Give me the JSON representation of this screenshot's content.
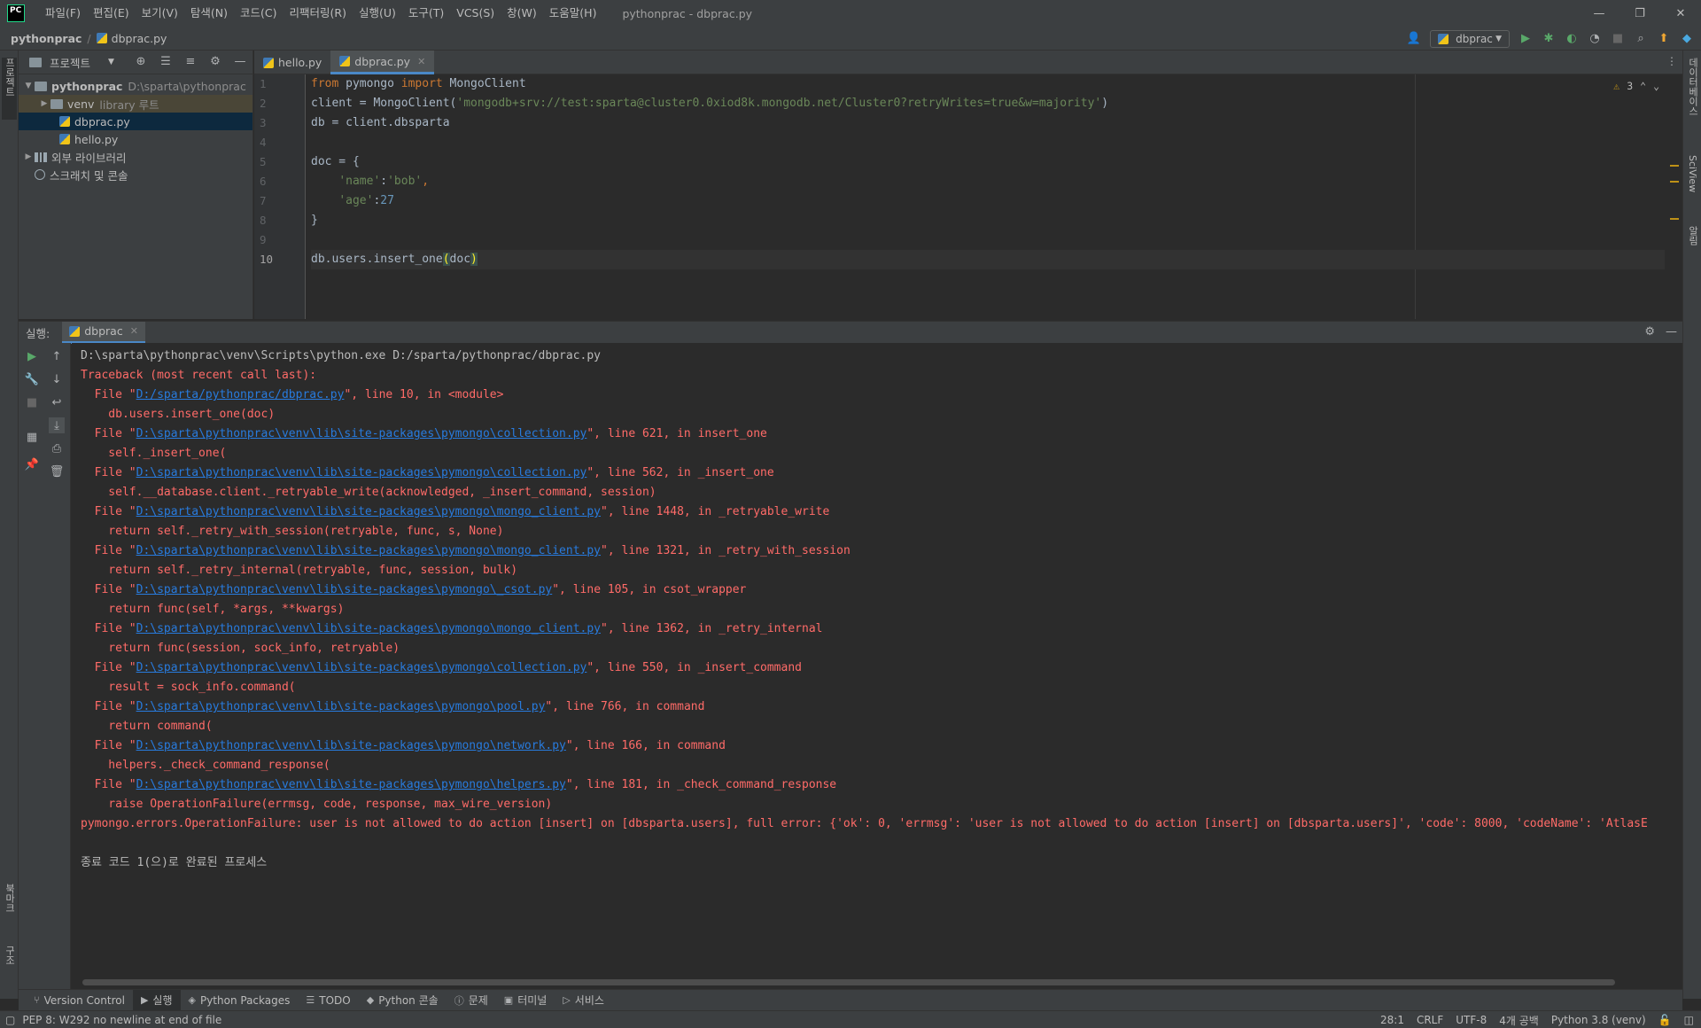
{
  "menubar": {
    "logo": "PC",
    "items": [
      "파일(F)",
      "편집(E)",
      "보기(V)",
      "탐색(N)",
      "코드(C)",
      "리팩터링(R)",
      "실행(U)",
      "도구(T)",
      "VCS(S)",
      "창(W)",
      "도움말(H)"
    ],
    "window_title": "pythonprac - dbprac.py"
  },
  "navbar": {
    "project": "pythonprac",
    "file": "dbprac.py",
    "run_config": "dbprac"
  },
  "project_panel": {
    "title": "프로젝트",
    "root_name": "pythonprac",
    "root_path": "D:\\sparta\\pythonprac",
    "venv_name": "venv",
    "venv_hint": "library 루트",
    "file1": "dbprac.py",
    "file2": "hello.py",
    "external_libs": "외부 라이브러리",
    "scratches": "스크래치 및 콘솔"
  },
  "left_strip": {
    "project": "프로젝트",
    "bookmarks": "북마크",
    "structure": "구조"
  },
  "right_strip": {
    "database": "데이터베이스",
    "sciview": "SciView",
    "notifications": "알림"
  },
  "editor": {
    "tabs": [
      "hello.py",
      "dbprac.py"
    ],
    "warnings": "3",
    "lines": [
      "1",
      "2",
      "3",
      "4",
      "5",
      "6",
      "7",
      "8",
      "9",
      "10"
    ],
    "code": {
      "l1_kw1": "from",
      "l1_mod": " pymongo ",
      "l1_kw2": "import",
      "l1_rest": " MongoClient",
      "l2_a": "client = MongoClient(",
      "l2_str": "'mongodb+srv://test:sparta@cluster0.0xiod8k.mongodb.net/Cluster0?retryWrites=true&w=majority'",
      "l2_b": ")",
      "l3": "db = client.dbsparta",
      "l5": "doc = {",
      "l6_str1": "'name'",
      "l6_colon": ":",
      "l6_str2": "'bob'",
      "l6_comma": ",",
      "l7_str": "'age'",
      "l7_colon": ":",
      "l7_num": "27",
      "l8": "}",
      "l10_a": "db.users.insert_one",
      "l10_p1": "(",
      "l10_b": "doc",
      "l10_p2": ")"
    }
  },
  "run_panel": {
    "label": "실행:",
    "tab": "dbprac",
    "command": "D:\\sparta\\pythonprac\\venv\\Scripts\\python.exe D:/sparta/pythonprac/dbprac.py",
    "traceback": "Traceback (most recent call last):",
    "frames": [
      {
        "path": "D:/sparta/pythonprac/dbprac.py",
        "tail": "\", line 10, in <module>",
        "code": "    db.users.insert_one(doc)"
      },
      {
        "path": "D:\\sparta\\pythonprac\\venv\\lib\\site-packages\\pymongo\\collection.py",
        "tail": "\", line 621, in insert_one",
        "code": "    self._insert_one("
      },
      {
        "path": "D:\\sparta\\pythonprac\\venv\\lib\\site-packages\\pymongo\\collection.py",
        "tail": "\", line 562, in _insert_one",
        "code": "    self.__database.client._retryable_write(acknowledged, _insert_command, session)"
      },
      {
        "path": "D:\\sparta\\pythonprac\\venv\\lib\\site-packages\\pymongo\\mongo_client.py",
        "tail": "\", line 1448, in _retryable_write",
        "code": "    return self._retry_with_session(retryable, func, s, None)"
      },
      {
        "path": "D:\\sparta\\pythonprac\\venv\\lib\\site-packages\\pymongo\\mongo_client.py",
        "tail": "\", line 1321, in _retry_with_session",
        "code": "    return self._retry_internal(retryable, func, session, bulk)"
      },
      {
        "path": "D:\\sparta\\pythonprac\\venv\\lib\\site-packages\\pymongo\\_csot.py",
        "tail": "\", line 105, in csot_wrapper",
        "code": "    return func(self, *args, **kwargs)"
      },
      {
        "path": "D:\\sparta\\pythonprac\\venv\\lib\\site-packages\\pymongo\\mongo_client.py",
        "tail": "\", line 1362, in _retry_internal",
        "code": "    return func(session, sock_info, retryable)"
      },
      {
        "path": "D:\\sparta\\pythonprac\\venv\\lib\\site-packages\\pymongo\\collection.py",
        "tail": "\", line 550, in _insert_command",
        "code": "    result = sock_info.command("
      },
      {
        "path": "D:\\sparta\\pythonprac\\venv\\lib\\site-packages\\pymongo\\pool.py",
        "tail": "\", line 766, in command",
        "code": "    return command("
      },
      {
        "path": "D:\\sparta\\pythonprac\\venv\\lib\\site-packages\\pymongo\\network.py",
        "tail": "\", line 166, in command",
        "code": "    helpers._check_command_response("
      },
      {
        "path": "D:\\sparta\\pythonprac\\venv\\lib\\site-packages\\pymongo\\helpers.py",
        "tail": "\", line 181, in _check_command_response",
        "code": "    raise OperationFailure(errmsg, code, response, max_wire_version)"
      }
    ],
    "error": "pymongo.errors.OperationFailure: user is not allowed to do action [insert] on [dbsparta.users], full error: {'ok': 0, 'errmsg': 'user is not allowed to do action [insert] on [dbsparta.users]', 'code': 8000, 'codeName': 'AtlasE",
    "exit": "종료 코드 1(으)로 완료된 프로세스"
  },
  "bottom_tools": [
    "Version Control",
    "실행",
    "Python Packages",
    "TODO",
    "Python 콘솔",
    "문제",
    "터미널",
    "서비스"
  ],
  "statusbar": {
    "message": "PEP 8: W292 no newline at end of file",
    "position": "28:1",
    "line_sep": "CRLF",
    "encoding": "UTF-8",
    "indent": "4개 공백",
    "interpreter": "Python 3.8 (venv)"
  }
}
